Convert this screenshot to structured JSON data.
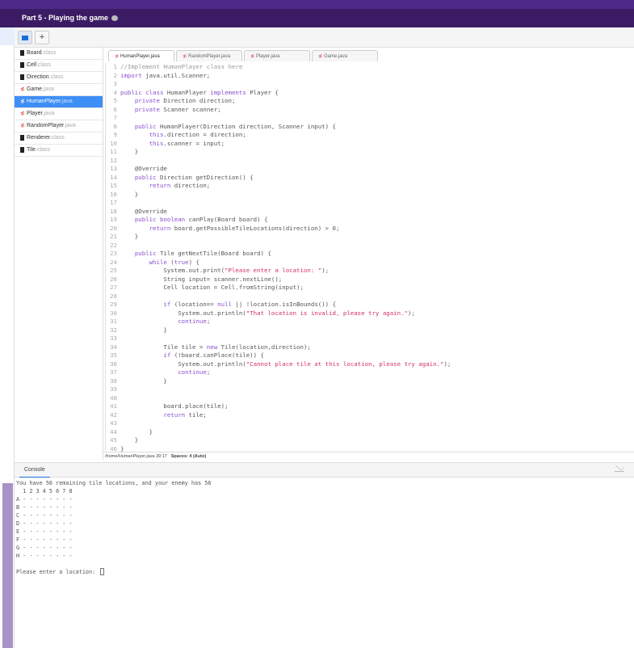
{
  "title": "Part 5 - Playing the game",
  "toolbar": {
    "folder_label": "",
    "add_label": "+"
  },
  "files": [
    {
      "name": "Board",
      "ext": ".class",
      "type": "class"
    },
    {
      "name": "Cell",
      "ext": ".class",
      "type": "class"
    },
    {
      "name": "Direction",
      "ext": ".class",
      "type": "class"
    },
    {
      "name": "Game",
      "ext": ".java",
      "type": "java"
    },
    {
      "name": "HumanPlayer",
      "ext": ".java",
      "type": "java",
      "active": true
    },
    {
      "name": "Player",
      "ext": ".java",
      "type": "java"
    },
    {
      "name": "RandomPlayer",
      "ext": ".java",
      "type": "java"
    },
    {
      "name": "Renderer",
      "ext": ".class",
      "type": "class"
    },
    {
      "name": "Tile",
      "ext": ".class",
      "type": "class"
    }
  ],
  "tabs": [
    "HumanPlayer.java",
    "RandomPlayer.java",
    "Player.java",
    "Game.java"
  ],
  "code": [
    "//Implement HumanPlayer class here",
    "import java.util.Scanner;",
    "",
    "public class HumanPlayer implements Player {",
    "    private Direction direction;",
    "    private Scanner scanner;",
    "",
    "    public HumanPlayer(Direction direction, Scanner input) {",
    "        this.direction = direction;",
    "        this.scanner = input;",
    "    }",
    "",
    "    @Override",
    "    public Direction getDirection() {",
    "        return direction;",
    "    }",
    "",
    "    @Override",
    "    public boolean canPlay(Board board) {",
    "        return board.getPossibleTileLocations(direction) > 0;",
    "    }",
    "",
    "    public Tile getNextTile(Board board) {",
    "        while (true) {",
    "            System.out.print(\"Please enter a location: \");",
    "            String input= scanner.nextLine();",
    "            Cell location = Cell.fromString(input);",
    "",
    "            if (location== null || !location.isInBounds()) {",
    "                System.out.println(\"That location is invalid, please try again.\");",
    "                continue;",
    "            }",
    "",
    "            Tile tile = new Tile(location,direction);",
    "            if (!board.canPlace(tile)) {",
    "                System.out.println(\"Cannot place tile at this location, please try again.\");",
    "                continue;",
    "            }",
    "",
    "",
    "            board.place(tile);",
    "            return tile;",
    "",
    "        }",
    "    }",
    "}"
  ],
  "status": {
    "path": "/home/HumanPlayer.java 39:17",
    "spaces": "Spaces: 4 (Auto)"
  },
  "console": {
    "tab": "Console",
    "lines": [
      "You have 56 remaining tile locations, and your enemy has 56",
      "  1 2 3 4 5 6 7 8",
      "A - - - - - - - -",
      "B - - - - - - - -",
      "C - - - - - - - -",
      "D - - - - - - - -",
      "E - - - - - - - -",
      "F - - - - - - - -",
      "G - - - - - - - -",
      "H - - - - - - - -",
      ""
    ],
    "prompt": "Please enter a location: "
  }
}
